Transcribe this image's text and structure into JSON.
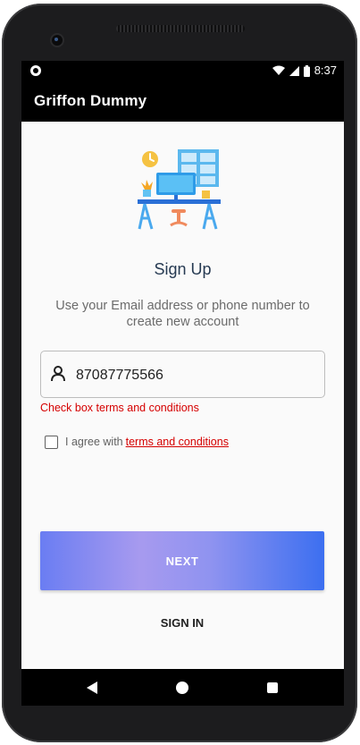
{
  "status_bar": {
    "time": "8:37",
    "icons": [
      "notification-dot-icon",
      "wifi-icon",
      "cell-signal-icon",
      "battery-icon"
    ]
  },
  "app_bar": {
    "title": "Griffon Dummy"
  },
  "signup": {
    "heading": "Sign Up",
    "subtitle": "Use your Email address or phone number to create new account",
    "input": {
      "value": "87087775566",
      "icon": "person-icon"
    },
    "error_text": "Check box terms and conditions",
    "agree": {
      "prefix": "I agree with",
      "link": "terms and conditions",
      "checked": false
    },
    "next_label": "NEXT",
    "signin_label": "SIGN IN"
  },
  "nav_bar": {
    "icons": [
      "back-icon",
      "home-icon",
      "recents-icon"
    ]
  },
  "colors": {
    "accent_error": "#d50000",
    "heading": "#263a52",
    "button_gradient_start": "#6a7df2",
    "button_gradient_mid": "#a79aef",
    "button_gradient_end": "#3c6ff0"
  }
}
